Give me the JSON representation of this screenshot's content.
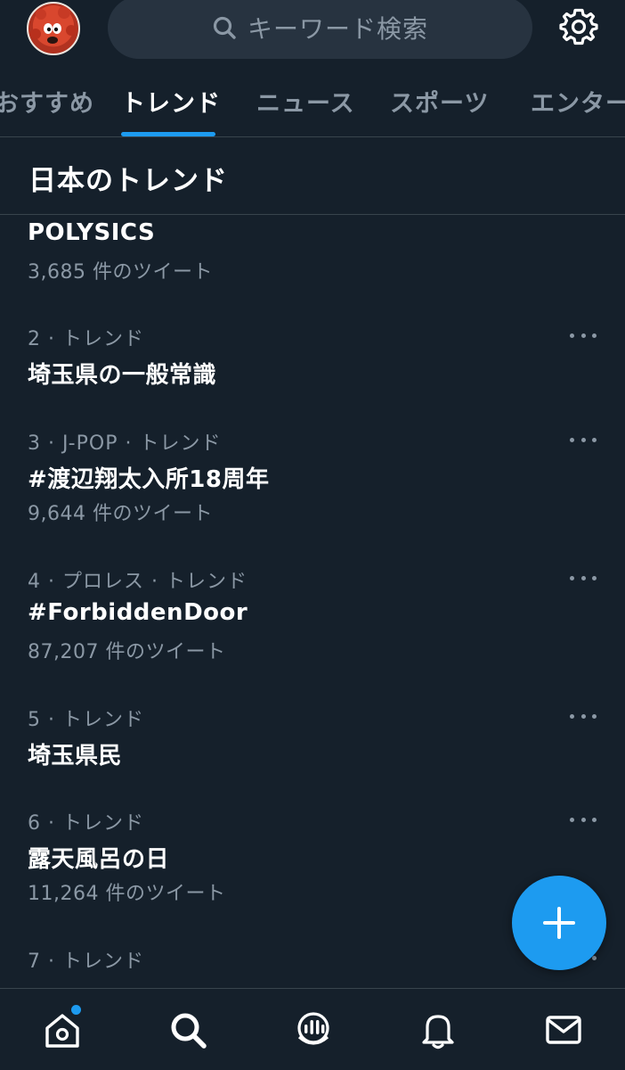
{
  "header": {
    "search_placeholder": "キーワード検索"
  },
  "tabs": [
    {
      "label": "おすすめ"
    },
    {
      "label": "トレンド",
      "active": true
    },
    {
      "label": "ニュース"
    },
    {
      "label": "スポーツ"
    },
    {
      "label": "エンターテイメント"
    }
  ],
  "section": {
    "title": "日本のトレンド"
  },
  "trends": [
    {
      "name": "POLYSICS",
      "count": "3,685 件のツイート"
    },
    {
      "meta": "2 · トレンド",
      "name": "埼玉県の一般常識"
    },
    {
      "meta": "3 · J-POP · トレンド",
      "name": "#渡辺翔太入所18周年",
      "count": "9,644 件のツイート"
    },
    {
      "meta": "4 · プロレス · トレンド",
      "name": "#ForbiddenDoor",
      "count": "87,207 件のツイート"
    },
    {
      "meta": "5 · トレンド",
      "name": "埼玉県民"
    },
    {
      "meta": "6 · トレンド",
      "name": "露天風呂の日",
      "count": "11,264 件のツイート"
    },
    {
      "meta": "7 · トレンド"
    }
  ],
  "colors": {
    "background": "#15202b",
    "accent": "#1d9bf0",
    "secondary_text": "#8b98a5",
    "divider": "#38444d"
  },
  "icons": {
    "search": "search-icon",
    "settings": "gear-icon",
    "more": "more-icon",
    "compose": "plus-icon",
    "nav": [
      "home-icon",
      "search-icon",
      "spaces-icon",
      "bell-icon",
      "mail-icon"
    ]
  }
}
